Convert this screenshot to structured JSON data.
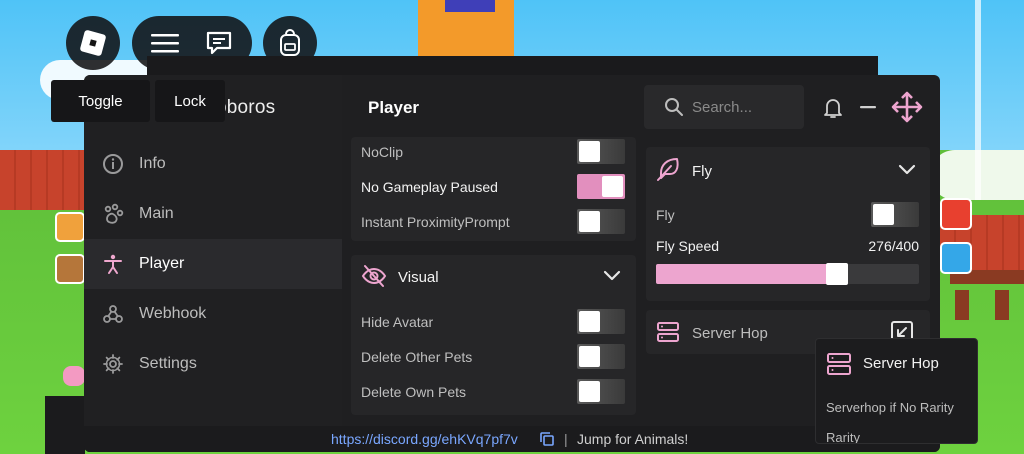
{
  "topbar": {
    "roblox_icon": "roblox-logo-icon",
    "menu_icon": "hamburger-menu-icon",
    "chat_icon": "chat-icon",
    "backpack_icon": "backpack-icon"
  },
  "overlay_buttons": {
    "toggle_label": "Toggle",
    "lock_label": "Lock"
  },
  "window": {
    "brand": "oboros",
    "page_title": "Player",
    "search_placeholder": "Search..."
  },
  "sidebar": {
    "items": [
      {
        "label": "Info",
        "icon": "info-icon"
      },
      {
        "label": "Main",
        "icon": "paw-icon"
      },
      {
        "label": "Player",
        "icon": "person-icon"
      },
      {
        "label": "Webhook",
        "icon": "webhook-icon"
      },
      {
        "label": "Settings",
        "icon": "gear-icon"
      }
    ]
  },
  "movement": {
    "noclip_label": "NoClip",
    "no_gameplay_paused_label": "No Gameplay Paused",
    "instant_prompt_label": "Instant ProximityPrompt"
  },
  "visual": {
    "title": "Visual",
    "hide_avatar_label": "Hide Avatar",
    "delete_other_pets_label": "Delete Other Pets",
    "delete_own_pets_label": "Delete Own Pets"
  },
  "fly": {
    "title": "Fly",
    "fly_label": "Fly",
    "speed_label": "Fly Speed",
    "speed_value_text": "276/400",
    "speed_value": 276,
    "speed_max": 400
  },
  "server_hop": {
    "title": "Server Hop"
  },
  "dropdown": {
    "title": "Server Hop",
    "option_1": "Serverhop if No Rarity",
    "option_2": "Rarity"
  },
  "footer": {
    "discord_link": "https://discord.gg/ehKVq7pf7v",
    "separator": "|",
    "game_name": "Jump for Animals!"
  },
  "colors": {
    "accent": "#eda5cf",
    "panel": "#1f1f21",
    "card": "#262628"
  }
}
